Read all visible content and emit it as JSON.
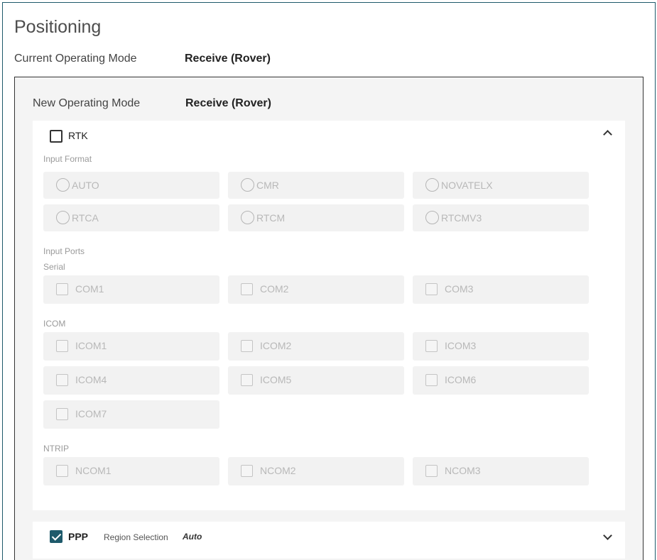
{
  "page": {
    "title": "Positioning",
    "current_mode_label": "Current Operating Mode",
    "current_mode_value": "Receive (Rover)",
    "new_mode_label": "New Operating Mode",
    "new_mode_value": "Receive (Rover)"
  },
  "rtk": {
    "label": "RTK",
    "checked": false,
    "expanded": true,
    "input_format_label": "Input Format",
    "input_formats": [
      "AUTO",
      "CMR",
      "NOVATELX",
      "RTCA",
      "RTCM",
      "RTCMV3"
    ],
    "input_ports_label": "Input Ports",
    "serial_label": "Serial",
    "serial_ports": [
      "COM1",
      "COM2",
      "COM3"
    ],
    "icom_label": "ICOM",
    "icom_ports": [
      "ICOM1",
      "ICOM2",
      "ICOM3",
      "ICOM4",
      "ICOM5",
      "ICOM6",
      "ICOM7"
    ],
    "ntrip_label": "NTRIP",
    "ntrip_ports": [
      "NCOM1",
      "NCOM2",
      "NCOM3"
    ]
  },
  "ppp": {
    "label": "PPP",
    "checked": true,
    "expanded": false,
    "region_label": "Region Selection",
    "region_value": "Auto"
  },
  "icons": {
    "rtk_collapse": "chevron-up-icon",
    "ppp_expand": "chevron-down-icon",
    "checkbox_checked": "check-icon"
  },
  "colors": {
    "accent": "#1e5a6b",
    "disabled_text": "#b8b8b8",
    "option_bg": "#f2f2f2",
    "section_bg": "#f4f4f4"
  }
}
